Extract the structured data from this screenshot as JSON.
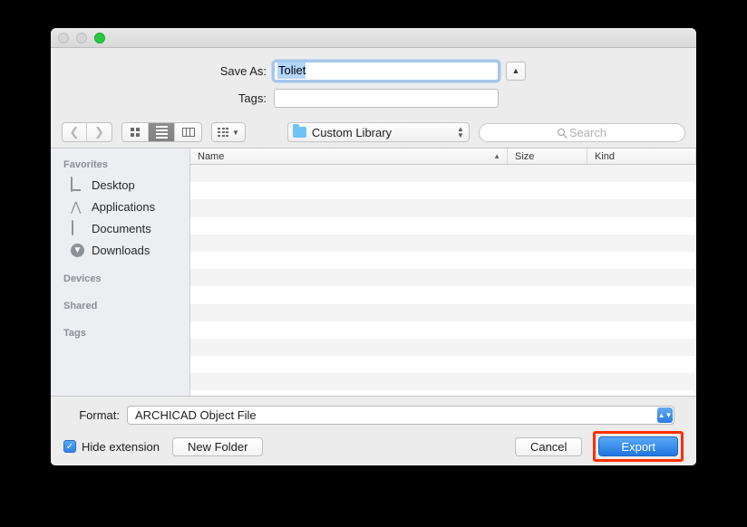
{
  "window": {
    "traffic_lights": [
      "close",
      "minimize",
      "zoom"
    ],
    "accent_color": "#2f82e4",
    "highlight_color": "#ff2f00"
  },
  "form": {
    "save_as_label": "Save As:",
    "save_as_value": "Toliet",
    "tags_label": "Tags:",
    "tags_value": "",
    "expand_icon": "chevron-up-icon"
  },
  "toolbar": {
    "back_icon": "chevron-left-icon",
    "forward_icon": "chevron-right-icon",
    "view_icon_label": "icon-view",
    "view_list_label": "list-view",
    "view_column_label": "column-view",
    "arrange_label": "arrange-by",
    "path_label": "Custom Library",
    "search_placeholder": "Search"
  },
  "sidebar": {
    "sections": [
      {
        "title": "Favorites",
        "items": [
          {
            "label": "Desktop",
            "icon": "desktop-icon"
          },
          {
            "label": "Applications",
            "icon": "applications-icon"
          },
          {
            "label": "Documents",
            "icon": "documents-icon"
          },
          {
            "label": "Downloads",
            "icon": "downloads-icon"
          }
        ]
      },
      {
        "title": "Devices",
        "items": []
      },
      {
        "title": "Shared",
        "items": []
      },
      {
        "title": "Tags",
        "items": []
      }
    ]
  },
  "filelist": {
    "columns": [
      "Name",
      "Size",
      "Kind"
    ],
    "sort_arrow": "chevron-up-icon",
    "rows": []
  },
  "bottom": {
    "format_label": "Format:",
    "format_value": "ARCHICAD Object File",
    "hide_extension_label": "Hide extension",
    "hide_extension_checked": true,
    "new_folder_label": "New Folder",
    "cancel_label": "Cancel",
    "export_label": "Export"
  }
}
